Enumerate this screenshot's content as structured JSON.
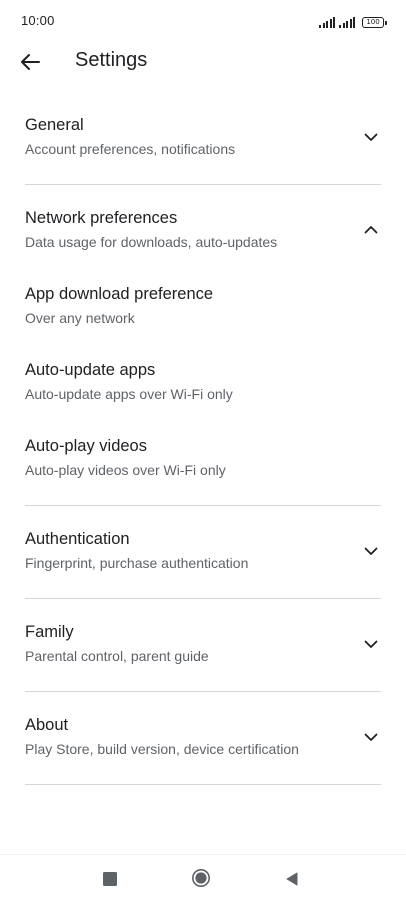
{
  "status_bar": {
    "time": "10:00",
    "battery": "100",
    "icons": [
      "signal-icon",
      "signal-icon",
      "battery-icon"
    ]
  },
  "app_bar": {
    "back_icon": "arrow-back-icon",
    "title": "Settings"
  },
  "sections": [
    {
      "title": "General",
      "subtitle": "Account preferences, notifications",
      "expanded": false
    },
    {
      "title": "Network preferences",
      "subtitle": "Data usage for downloads, auto-updates",
      "expanded": true,
      "items": [
        {
          "title": "App download preference",
          "subtitle": "Over any network"
        },
        {
          "title": "Auto-update apps",
          "subtitle": "Auto-update apps over Wi-Fi only"
        },
        {
          "title": "Auto-play videos",
          "subtitle": "Auto-play videos over Wi-Fi only"
        }
      ]
    },
    {
      "title": "Authentication",
      "subtitle": "Fingerprint, purchase authentication",
      "expanded": false
    },
    {
      "title": "Family",
      "subtitle": "Parental control, parent guide",
      "expanded": false
    },
    {
      "title": "About",
      "subtitle": "Play Store, build version, device certification",
      "expanded": false
    }
  ],
  "nav_bar": {
    "icons": [
      "recents-square-icon",
      "home-circle-icon",
      "back-triangle-icon"
    ]
  },
  "colors": {
    "text_primary": "#202124",
    "text_secondary": "#5f6368",
    "divider": "#d5d7da",
    "background": "#ffffff"
  }
}
